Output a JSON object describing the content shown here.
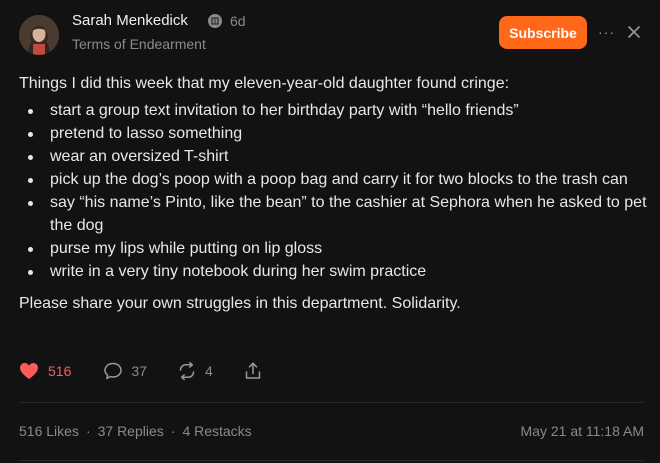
{
  "header": {
    "author": "Sarah Menkedick",
    "time_ago": "6d",
    "publication": "Terms of Endearment",
    "subscribe_label": "Subscribe",
    "more_label": "···"
  },
  "post": {
    "intro": "Things I did this week that my eleven-year-old daughter found cringe:",
    "items": [
      "start a group text invitation to her birthday party with “hello friends”",
      "pretend to lasso something",
      "wear an oversized T-shirt",
      "pick up the dog’s poop with a poop bag and carry it for two blocks to the trash can",
      "say “his name’s Pinto, like the bean” to the cashier at Sephora when he asked to pet the dog",
      "purse my lips while putting on lip gloss",
      "write in a very tiny notebook during her swim practice"
    ],
    "outro": "Please share your own struggles in this department. Solidarity."
  },
  "actions": {
    "likes": "516",
    "replies": "37",
    "restacks": "4"
  },
  "stats": {
    "likes_label": "516 Likes",
    "replies_label": "37 Replies",
    "restacks_label": "4 Restacks",
    "separator": "·",
    "date": "May 21 at 11:18 AM"
  },
  "colors": {
    "accent": "#ff6719",
    "like": "#ff5a5a",
    "background": "#121212"
  }
}
